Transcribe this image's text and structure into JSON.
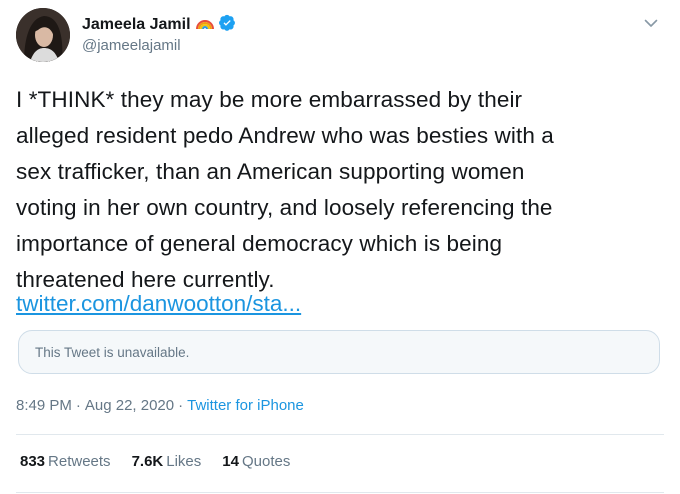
{
  "tweet": {
    "author": {
      "name": "Jameela Jamil",
      "handle": "@jameelajamil",
      "icons": [
        "rainbow-icon",
        "verified-badge-icon"
      ]
    },
    "body_lines": [
      "I *THINK* they may be more embarrassed by their",
      "alleged resident pedo Andrew who was besties with a",
      "sex trafficker, than an American supporting women",
      "voting in her own country, and loosely referencing the",
      "importance of general democracy which is being",
      "threatened here currently."
    ],
    "link": "twitter.com/danwootton/sta...",
    "quoted": {
      "text": "This Tweet is unavailable."
    },
    "meta": {
      "time": "8:49 PM",
      "sep1": "·",
      "date": "Aug 22, 2020",
      "sep2": "·",
      "source": "Twitter for iPhone"
    },
    "stats": [
      {
        "count": "833",
        "label": "Retweets"
      },
      {
        "count": "7.6K",
        "label": "Likes"
      },
      {
        "count": "14",
        "label": "Quotes"
      }
    ]
  },
  "colors": {
    "link": "#1b95e0",
    "secondary_text": "#657786",
    "primary_text": "#14171a",
    "verified": "#1da1f2",
    "border": "#e1e8ed"
  }
}
